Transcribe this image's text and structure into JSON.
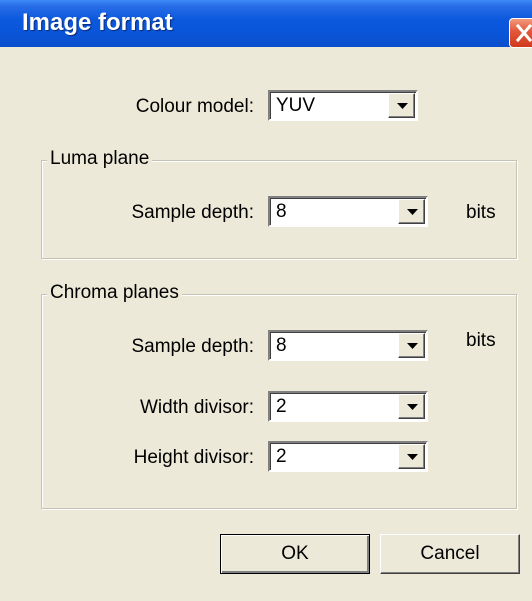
{
  "dialog": {
    "title": "Image format"
  },
  "colour_model": {
    "label": "Colour model:",
    "value": "YUV"
  },
  "luma_plane": {
    "legend": "Luma plane",
    "sample_depth_label": "Sample depth:",
    "sample_depth_value": "8",
    "unit": "bits"
  },
  "chroma_planes": {
    "legend": "Chroma planes",
    "sample_depth_label": "Sample depth:",
    "sample_depth_value": "8",
    "unit": "bits",
    "width_divisor_label": "Width divisor:",
    "width_divisor_value": "2",
    "height_divisor_label": "Height divisor:",
    "height_divisor_value": "2"
  },
  "buttons": {
    "ok": "OK",
    "cancel": "Cancel"
  },
  "colors": {
    "title_bar": "#0a55d8",
    "dialog_face": "#ece9d8",
    "close_button": "#e3553a"
  }
}
